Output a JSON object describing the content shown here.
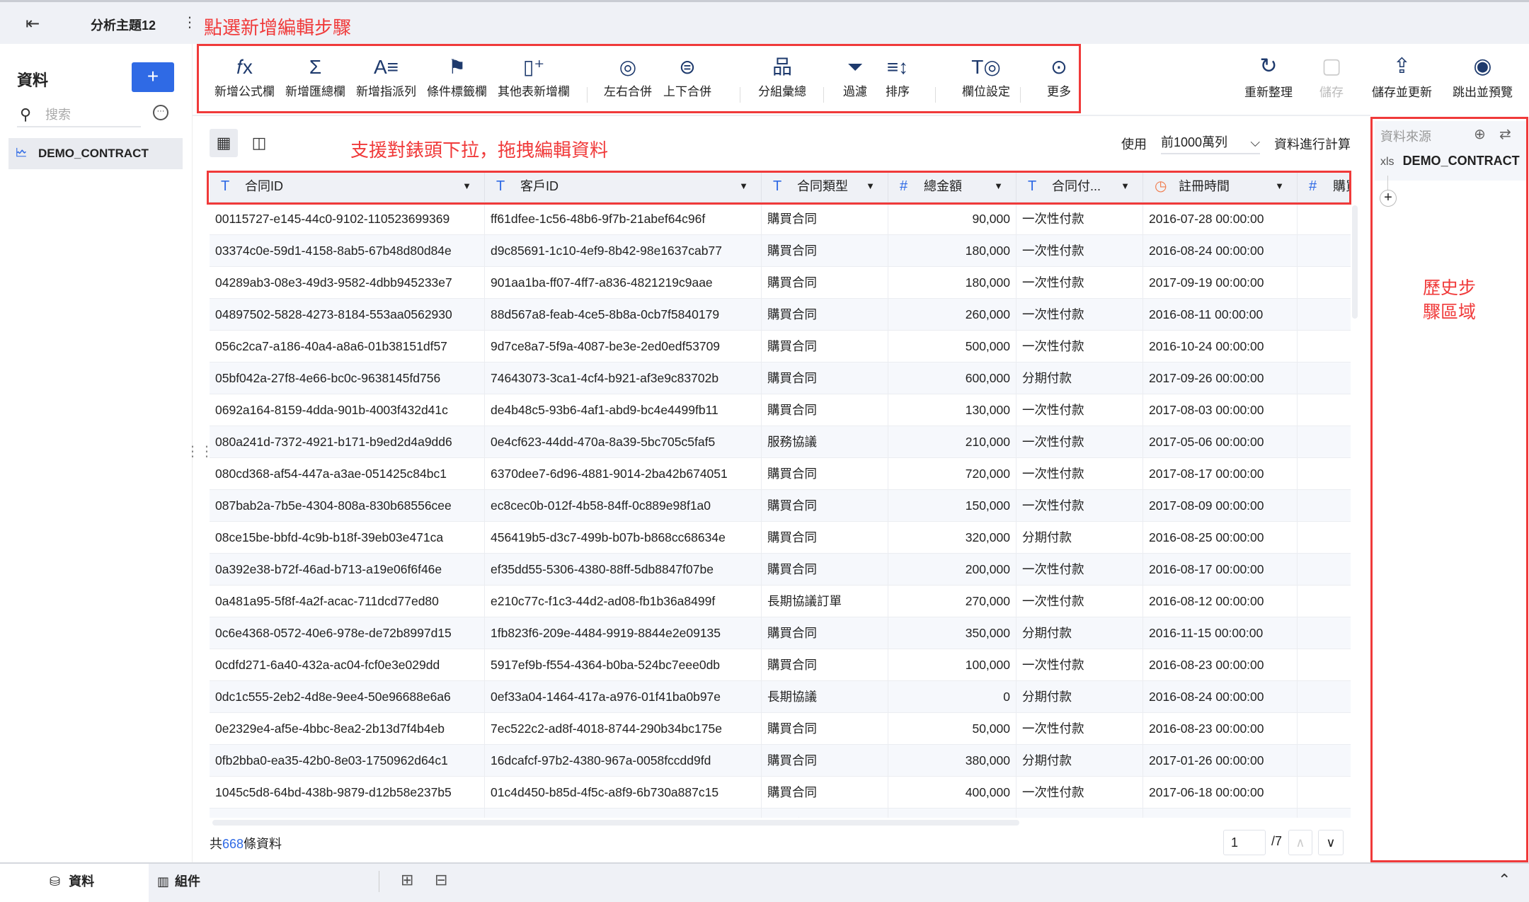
{
  "topbar": {
    "back_icon": "exit-icon",
    "title": "分析主題12",
    "more_icon": "vertical-dots-icon",
    "annotation": "點選新增編輯步驟"
  },
  "sidebar": {
    "title": "資料",
    "add_label": "+",
    "search_placeholder": "搜索",
    "item": "DEMO_CONTRACT"
  },
  "toolbar": {
    "items": [
      {
        "label": "新增公式欄",
        "icon": "𝑓x"
      },
      {
        "label": "新增匯總欄",
        "icon": "Σ"
      },
      {
        "label": "新增指派列",
        "icon": "A≡"
      },
      {
        "label": "條件標籤欄",
        "icon": "⚑"
      },
      {
        "label": "其他表新增欄",
        "icon": "▯⁺"
      },
      {
        "label": "左右合併",
        "icon": "◎"
      },
      {
        "label": "上下合併",
        "icon": "⊜"
      },
      {
        "label": "分組彙總",
        "icon": "品"
      },
      {
        "label": "過濾",
        "icon": "⏷"
      },
      {
        "label": "排序",
        "icon": "≡↕"
      },
      {
        "label": "欄位設定",
        "icon": "T◎"
      },
      {
        "label": "更多",
        "icon": "⊙"
      }
    ],
    "right": [
      {
        "label": "重新整理",
        "icon": "↻"
      },
      {
        "label": "儲存",
        "icon": "▢",
        "disabled": true
      },
      {
        "label": "儲存並更新",
        "icon": "⇪"
      },
      {
        "label": "跳出並預覽",
        "icon": "◉"
      }
    ]
  },
  "view": {
    "annotation": "支援對錶頭下拉，拖拽編輯資料",
    "use_label": "使用",
    "row_limit": "前1000萬列",
    "calc_label": "資料進行計算"
  },
  "table": {
    "columns": [
      {
        "label": "合同ID",
        "type": "T"
      },
      {
        "label": "客戶ID",
        "type": "T"
      },
      {
        "label": "合同類型",
        "type": "T"
      },
      {
        "label": "總金額",
        "type": "#"
      },
      {
        "label": "合同付...",
        "type": "T"
      },
      {
        "label": "註冊時間",
        "type": "clock"
      },
      {
        "label": "購買",
        "type": "#"
      }
    ],
    "rows": [
      [
        "00115727-e145-44c0-9102-110523699369",
        "ff61dfee-1c56-48b6-9f7b-21abef64c96f",
        "購買合同",
        "90,000",
        "一次性付款",
        "2016-07-28 00:00:00"
      ],
      [
        "03374c0e-59d1-4158-8ab5-67b48d80d84e",
        "d9c85691-1c10-4ef9-8b42-98e1637cab77",
        "購買合同",
        "180,000",
        "一次性付款",
        "2016-08-24 00:00:00"
      ],
      [
        "04289ab3-08e3-49d3-9582-4dbb945233e7",
        "901aa1ba-ff07-4ff7-a836-4821219c9aae",
        "購買合同",
        "180,000",
        "一次性付款",
        "2017-09-19 00:00:00"
      ],
      [
        "04897502-5828-4273-8184-553aa0562930",
        "88d567a8-feab-4ce5-8b8a-0cb7f5840179",
        "購買合同",
        "260,000",
        "一次性付款",
        "2016-08-11 00:00:00"
      ],
      [
        "056c2ca7-a186-40a4-a8a6-01b38151df57",
        "9d7ce8a7-5f9a-4087-be3e-2ed0edf53709",
        "購買合同",
        "500,000",
        "一次性付款",
        "2016-10-24 00:00:00"
      ],
      [
        "05bf042a-27f8-4e66-bc0c-9638145fd756",
        "74643073-3ca1-4cf4-b921-af3e9c83702b",
        "購買合同",
        "600,000",
        "分期付款",
        "2017-09-26 00:00:00"
      ],
      [
        "0692a164-8159-4dda-901b-4003f432d41c",
        "de4b48c5-93b6-4af1-abd9-bc4e4499fb11",
        "購買合同",
        "130,000",
        "一次性付款",
        "2017-08-03 00:00:00"
      ],
      [
        "080a241d-7372-4921-b171-b9ed2d4a9dd6",
        "0e4cf623-44dd-470a-8a39-5bc705c5faf5",
        "服務協議",
        "210,000",
        "一次性付款",
        "2017-05-06 00:00:00"
      ],
      [
        "080cd368-af54-447a-a3ae-051425c84bc1",
        "6370dee7-6d96-4881-9014-2ba42b674051",
        "購買合同",
        "720,000",
        "一次性付款",
        "2017-08-17 00:00:00"
      ],
      [
        "087bab2a-7b5e-4304-808a-830b68556cee",
        "ec8cec0b-012f-4b58-84ff-0c889e98f1a0",
        "購買合同",
        "150,000",
        "一次性付款",
        "2017-08-09 00:00:00"
      ],
      [
        "08ce15be-bbfd-4c9b-b18f-39eb03e471ca",
        "456419b5-d3c7-499b-b07b-b868cc68634e",
        "購買合同",
        "320,000",
        "分期付款",
        "2016-08-25 00:00:00"
      ],
      [
        "0a392e38-b72f-46ad-b713-a19e06f6f46e",
        "ef35dd55-5306-4380-88ff-5db8847f07be",
        "購買合同",
        "200,000",
        "一次性付款",
        "2016-08-17 00:00:00"
      ],
      [
        "0a481a95-5f8f-4a2f-acac-711dcd77ed80",
        "e210c77c-f1c3-44d2-ad08-fb1b36a8499f",
        "長期協議訂單",
        "270,000",
        "一次性付款",
        "2016-08-12 00:00:00"
      ],
      [
        "0c6e4368-0572-40e6-978e-de72b8997d15",
        "1fb823f6-209e-4484-9919-8844e2e09135",
        "購買合同",
        "350,000",
        "分期付款",
        "2016-11-15 00:00:00"
      ],
      [
        "0cdfd271-6a40-432a-ac04-fcf0e3e029dd",
        "5917ef9b-f554-4364-b0ba-524bc7eee0db",
        "購買合同",
        "100,000",
        "一次性付款",
        "2016-08-23 00:00:00"
      ],
      [
        "0dc1c555-2eb2-4d8e-9ee4-50e96688e6a6",
        "0ef33a04-1464-417a-a976-01f41ba0b97e",
        "長期協議",
        "0",
        "分期付款",
        "2016-08-24 00:00:00"
      ],
      [
        "0e2329e4-af5e-4bbc-8ea2-2b13d7f4b4eb",
        "7ec522c2-ad8f-4018-8744-290b34bc175e",
        "購買合同",
        "50,000",
        "一次性付款",
        "2016-08-23 00:00:00"
      ],
      [
        "0fb2bba0-ea35-42b0-8e03-1750962d64c1",
        "16dcafcf-97b2-4380-967a-0058fccdd9fd",
        "購買合同",
        "380,000",
        "分期付款",
        "2017-01-26 00:00:00"
      ],
      [
        "1045c5d8-64bd-438b-9879-d12b58e237b5",
        "01c4d450-b85d-4f5c-a8f9-6b730a887c15",
        "購買合同",
        "400,000",
        "一次性付款",
        "2017-06-18 00:00:00"
      ],
      [
        "",
        "",
        "購買合同",
        "",
        "一次性付款",
        ""
      ]
    ]
  },
  "footer": {
    "prefix": "共",
    "count": "668",
    "suffix": "條資料",
    "page": "1",
    "total_pages": "/7"
  },
  "history": {
    "title": "資料來源",
    "source_type": "xls",
    "source": "DEMO_CONTRACT",
    "annotation": "歷史步驟區域"
  },
  "bottom": {
    "tab_data": "資料",
    "tab_component": "組件"
  }
}
